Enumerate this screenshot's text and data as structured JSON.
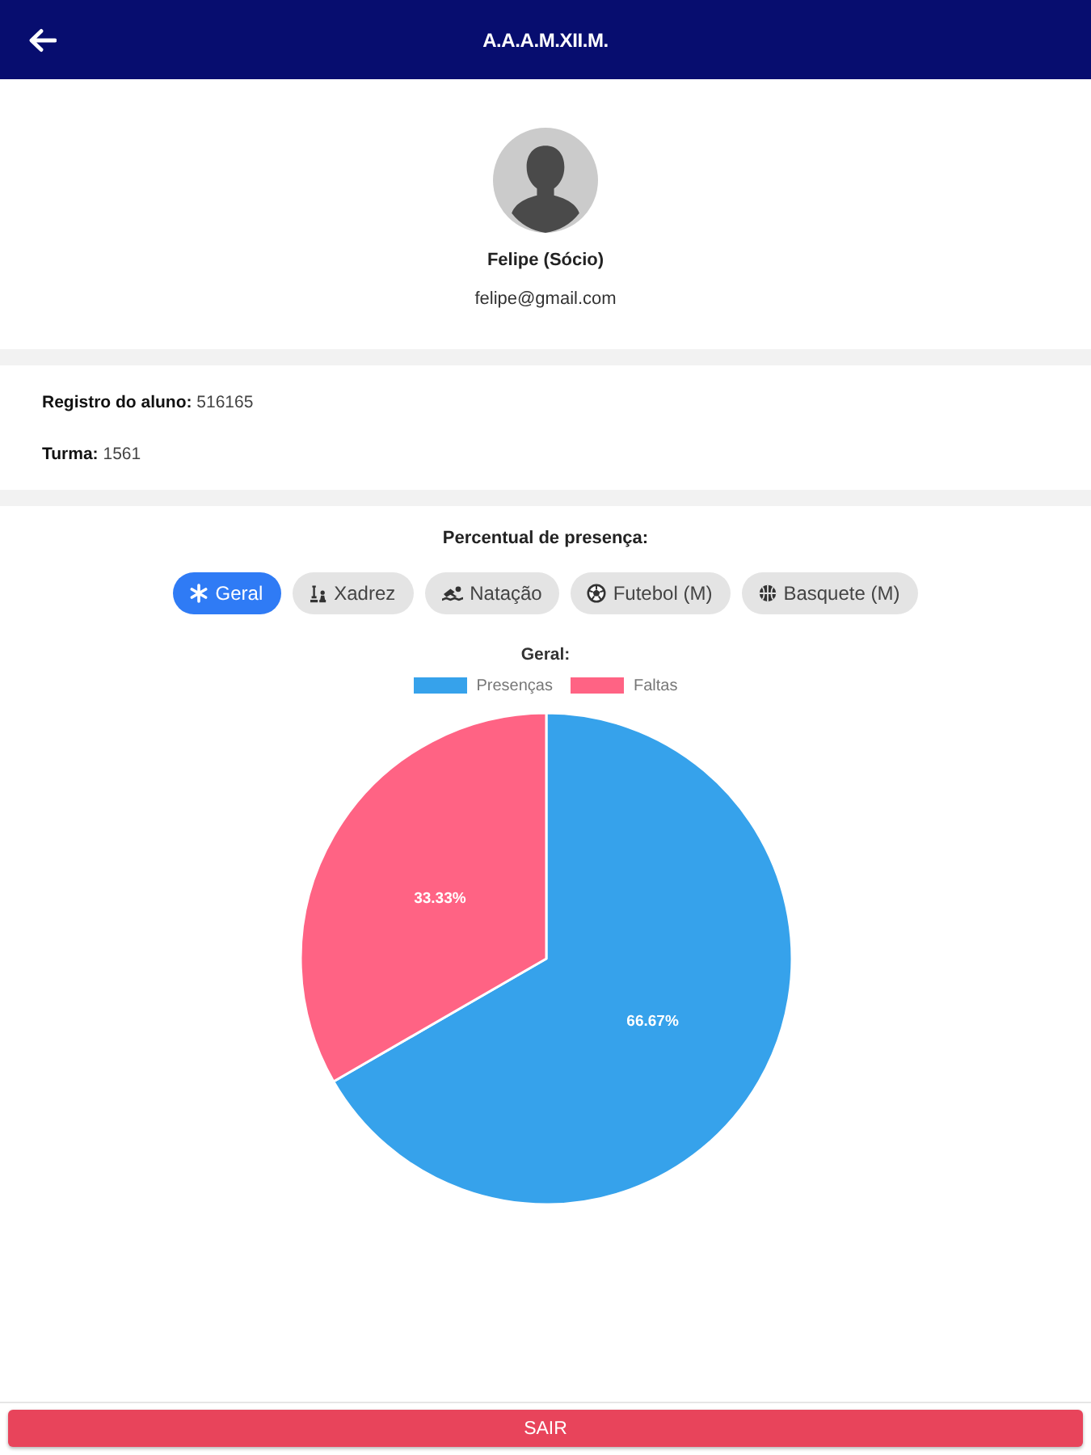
{
  "header": {
    "title": "A.A.A.M.XII.M."
  },
  "profile": {
    "name": "Felipe (Sócio)",
    "email": "felipe@gmail.com"
  },
  "details": [
    {
      "text": "**Registro do aluno:** 516165"
    },
    {
      "text": "**Turma:** 1561"
    }
  ],
  "attendance": {
    "heading": "Percentual de presença:",
    "filters": [
      {
        "label": "Geral",
        "kind": "general",
        "selected": true
      },
      {
        "label": "Xadrez",
        "kind": "chess",
        "selected": false
      },
      {
        "label": "Natação",
        "kind": "swimming",
        "selected": false
      },
      {
        "label": "Futebol (M)",
        "kind": "soccer",
        "selected": false
      },
      {
        "label": "Basquete (M)",
        "kind": "basketball",
        "selected": false
      }
    ],
    "chart_data": {
      "type": "pie",
      "title": "Geral:",
      "categories": [
        "Presenças",
        "Faltas"
      ],
      "values": [
        66.67,
        33.33
      ],
      "colors": [
        "#36a2eb",
        "#ff6384"
      ],
      "value_labels": [
        "66.67%",
        "33.33%"
      ]
    }
  },
  "logout_button": {
    "label": "SAIR"
  }
}
